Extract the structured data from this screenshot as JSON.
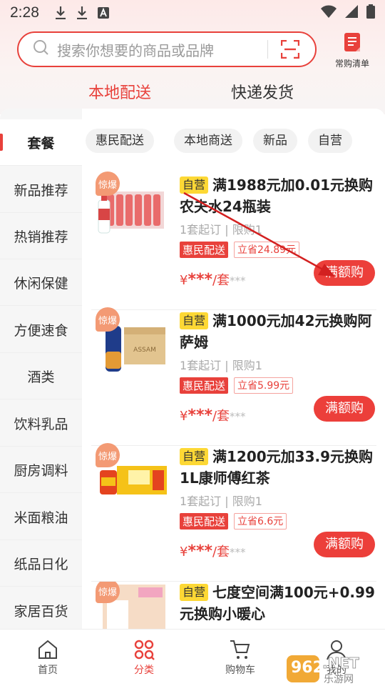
{
  "status_bar": {
    "time": "2:28",
    "icons": [
      "download-icon",
      "download-icon",
      "font-icon",
      "wifi-icon",
      "signal-icon",
      "battery-icon"
    ]
  },
  "search": {
    "placeholder": "搜索你想要的商品或品牌"
  },
  "header": {
    "frequent_list_label": "常购清单"
  },
  "delivery_tabs": [
    {
      "label": "本地配送",
      "active": true
    },
    {
      "label": "快递发货",
      "active": false
    }
  ],
  "sidebar": {
    "items": [
      {
        "label": "套餐",
        "active": true
      },
      {
        "label": "新品推荐"
      },
      {
        "label": "热销推荐"
      },
      {
        "label": "休闲保健"
      },
      {
        "label": "方便速食"
      },
      {
        "label": "酒类"
      },
      {
        "label": "饮料乳品"
      },
      {
        "label": "厨房调料"
      },
      {
        "label": "米面粮油"
      },
      {
        "label": "纸品日化"
      },
      {
        "label": "家居百货"
      }
    ]
  },
  "filters": [
    "惠民配送",
    "本地商送",
    "新品",
    "自营"
  ],
  "products": [
    {
      "badge": "惊爆",
      "self_tag": "自营",
      "title": "满1988元加0.01元换购农夫水24瓶装",
      "min_order": "1套起订",
      "limit": "限购1",
      "delivery_tag": "惠民配送",
      "save_tag": "立省24.89元",
      "price_prefix": "¥",
      "price": "***",
      "unit": "/套",
      "price_old": "***",
      "button": "满额购"
    },
    {
      "badge": "惊爆",
      "self_tag": "自营",
      "title": "满1000元加42元换购阿萨姆",
      "min_order": "1套起订",
      "limit": "限购1",
      "delivery_tag": "惠民配送",
      "save_tag": "立省5.99元",
      "price_prefix": "¥",
      "price": "***",
      "unit": "/套",
      "price_old": "***",
      "button": "满额购"
    },
    {
      "badge": "惊爆",
      "self_tag": "自营",
      "title": "满1200元加33.9元换购1L康师傅红茶",
      "min_order": "1套起订",
      "limit": "限购1",
      "delivery_tag": "惠民配送",
      "save_tag": "立省6.6元",
      "price_prefix": "¥",
      "price": "***",
      "unit": "/套",
      "price_old": "***",
      "button": "满额购"
    },
    {
      "badge": "惊爆",
      "self_tag": "自营",
      "title": "七度空间满100元+0.99元换购小暖心"
    }
  ],
  "bottom_nav": [
    {
      "label": "首页"
    },
    {
      "label": "分类",
      "active": true
    },
    {
      "label": "购物车"
    },
    {
      "label": "我的"
    }
  ],
  "watermark": "962.NET 乐游网",
  "colors": {
    "accent": "#e8413b",
    "self_tag": "#fdd835",
    "badge": "#f39a74"
  }
}
